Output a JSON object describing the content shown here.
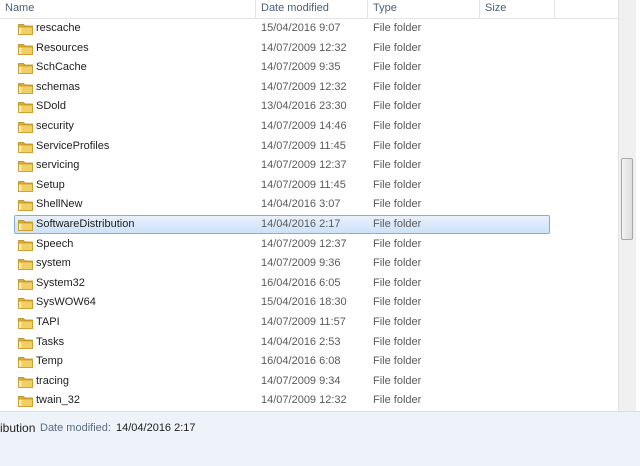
{
  "header": {
    "columns": [
      "Name",
      "Date modified",
      "Type",
      "Size"
    ]
  },
  "rows": [
    {
      "name": "rescache",
      "date": "15/04/2016 9:07",
      "type": "File folder"
    },
    {
      "name": "Resources",
      "date": "14/07/2009 12:32",
      "type": "File folder"
    },
    {
      "name": "SchCache",
      "date": "14/07/2009 9:35",
      "type": "File folder"
    },
    {
      "name": "schemas",
      "date": "14/07/2009 12:32",
      "type": "File folder"
    },
    {
      "name": "SDold",
      "date": "13/04/2016 23:30",
      "type": "File folder"
    },
    {
      "name": "security",
      "date": "14/07/2009 14:46",
      "type": "File folder"
    },
    {
      "name": "ServiceProfiles",
      "date": "14/07/2009 11:45",
      "type": "File folder"
    },
    {
      "name": "servicing",
      "date": "14/07/2009 12:37",
      "type": "File folder"
    },
    {
      "name": "Setup",
      "date": "14/07/2009 11:45",
      "type": "File folder"
    },
    {
      "name": "ShellNew",
      "date": "14/04/2016 3:07",
      "type": "File folder"
    },
    {
      "name": "SoftwareDistribution",
      "date": "14/04/2016 2:17",
      "type": "File folder",
      "selected": true
    },
    {
      "name": "Speech",
      "date": "14/07/2009 12:37",
      "type": "File folder"
    },
    {
      "name": "system",
      "date": "14/07/2009 9:36",
      "type": "File folder"
    },
    {
      "name": "System32",
      "date": "16/04/2016 6:05",
      "type": "File folder"
    },
    {
      "name": "SysWOW64",
      "date": "15/04/2016 18:30",
      "type": "File folder"
    },
    {
      "name": "TAPI",
      "date": "14/07/2009 11:57",
      "type": "File folder"
    },
    {
      "name": "Tasks",
      "date": "14/04/2016 2:53",
      "type": "File folder"
    },
    {
      "name": "Temp",
      "date": "16/04/2016 6:08",
      "type": "File folder"
    },
    {
      "name": "tracing",
      "date": "14/07/2009 9:34",
      "type": "File folder"
    },
    {
      "name": "twain_32",
      "date": "14/07/2009 12:32",
      "type": "File folder"
    }
  ],
  "status": {
    "name_fragment": "ibution",
    "date_label": "Date modified:",
    "date_value": "14/04/2016 2:17"
  },
  "colors": {
    "folder": "#e9c24a",
    "selection_border": "#84acdd",
    "header_text": "#4c607a"
  }
}
